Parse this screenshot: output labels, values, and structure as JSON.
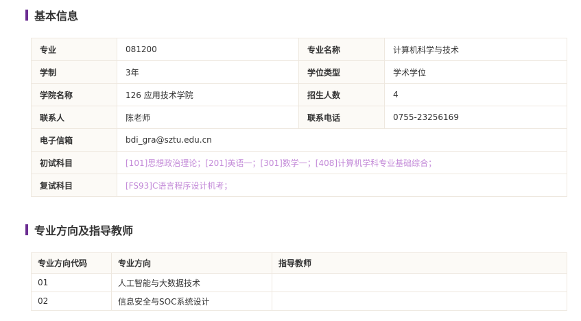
{
  "basic": {
    "title": "基本信息",
    "major_code_label": "专业",
    "major_code": "081200",
    "major_name_label": "专业名称",
    "major_name": "计算机科学与技术",
    "duration_label": "学制",
    "duration": "3年",
    "degree_type_label": "学位类型",
    "degree_type": "学术学位",
    "college_label": "学院名称",
    "college": "126 应用技术学院",
    "enrollment_label": "招生人数",
    "enrollment": "4",
    "contact_label": "联系人",
    "contact": "陈老师",
    "phone_label": "联系电话",
    "phone": "0755-23256169",
    "email_label": "电子信箱",
    "email": "bdi_gra@sztu.edu.cn",
    "initial_exam_label": "初试科目",
    "initial_exam": "[101]思想政治理论；[201]英语一；[301]数学一；[408]计算机学科专业基础综合；",
    "retest_label": "复试科目",
    "retest": "[FS93]C语言程序设计机考；"
  },
  "directions": {
    "title": "专业方向及指导教师",
    "headers": [
      "专业方向代码",
      "专业方向",
      "指导教师"
    ],
    "rows": [
      {
        "code": "01",
        "name": "人工智能与大数据技术",
        "advisor": ""
      },
      {
        "code": "02",
        "name": "信息安全与SOC系统设计",
        "advisor": ""
      }
    ]
  },
  "colors": {
    "accent": "#6b2c91",
    "link_purple": "#c38ad8",
    "label_bg": "#fcfaf6",
    "border": "#eee8df"
  }
}
